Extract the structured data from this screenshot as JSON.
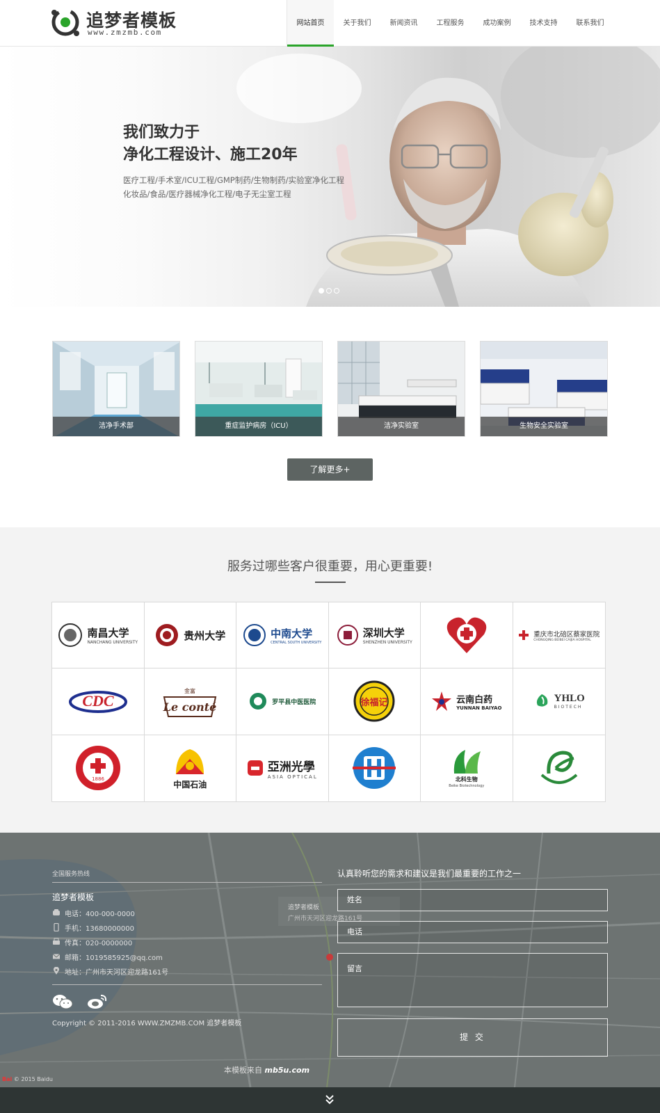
{
  "header": {
    "brand_name": "追梦者模板",
    "brand_url": "www.zmzmb.com",
    "nav": [
      {
        "label": "网站首页",
        "active": true
      },
      {
        "label": "关于我们"
      },
      {
        "label": "新闻资讯"
      },
      {
        "label": "工程服务"
      },
      {
        "label": "成功案例"
      },
      {
        "label": "技术支持"
      },
      {
        "label": "联系我们"
      }
    ]
  },
  "banner": {
    "headline_line1": "我们致力于",
    "headline_line2": "净化工程设计、施工20年",
    "sub_line1": "医疗工程/手术室/ICU工程/GMP制药/生物制药/实验室净化工程",
    "sub_line2": "化妆品/食品/医疗器械净化工程/电子无尘室工程",
    "slides": 3,
    "active_slide": 1
  },
  "services": {
    "items": [
      {
        "caption": "洁净手术部"
      },
      {
        "caption": "重症监护病房（ICU）"
      },
      {
        "caption": "洁净实验室"
      },
      {
        "caption": "生物安全实验室"
      }
    ],
    "more_label": "了解更多+"
  },
  "clients": {
    "title": "服务过哪些客户很重要，用心更重要!",
    "logos": [
      {
        "name": "南昌大学",
        "sub": "NANCHANG UNIVERSITY"
      },
      {
        "name": "贵州大学",
        "sub": ""
      },
      {
        "name": "中南大学",
        "sub": "CENTRAL SOUTH UNIVERSITY"
      },
      {
        "name": "深圳大学",
        "sub": "SHENZHEN UNIVERSITY"
      },
      {
        "name": "",
        "sub": ""
      },
      {
        "name": "重庆市北碚区蔡家医院",
        "sub": "CHONGQING BEIBEI CAIJIA HOSPITAL"
      },
      {
        "name": "CDC",
        "sub": ""
      },
      {
        "name": "Le conté",
        "sub": "金富"
      },
      {
        "name": "罗平县中医医院",
        "sub": ""
      },
      {
        "name": "徐福记",
        "sub": ""
      },
      {
        "name": "云南白药",
        "sub": "YUNNAN BAIYAO"
      },
      {
        "name": "YHLO",
        "sub": "BIOTECH"
      },
      {
        "name": "",
        "sub": "1886"
      },
      {
        "name": "中国石油",
        "sub": ""
      },
      {
        "name": "亞洲光學",
        "sub": "ASIA OPTICAL"
      },
      {
        "name": "",
        "sub": ""
      },
      {
        "name": "北科生物",
        "sub": "Beike Biotechnology"
      },
      {
        "name": "",
        "sub": ""
      }
    ]
  },
  "footer": {
    "hotline_label": "全国服务热线",
    "company": "追梦者模板",
    "phone": "电话：400-000-0000",
    "mobile": "手机：13680000000",
    "fax": "传真：020-0000000",
    "email": "邮箱：1019585925@qq.com",
    "address": "地址：广州市天河区迎龙路161号",
    "copyright": "Copyright © 2011-2016 WWW.ZMZMB.COM 追梦者模板",
    "form_lead": "认真聆听您的需求和建议是我们最重要的工作之一",
    "name_placeholder": "姓名",
    "phone_placeholder": "电话",
    "message_placeholder": "留言",
    "submit_label": "提 交",
    "map_credit_prefix": "本模板来自",
    "map_credit_brand": "mb5u.com",
    "map_popup_title": "追梦者模板",
    "map_popup_addr": "广州市天河区迎龙路161号",
    "baidu_brand": "Bai",
    "baidu_copy": "© 2015 Baidu"
  },
  "colors": {
    "accent": "#2aa42a",
    "button": "#5d6462",
    "footer_bar": "#2e3534"
  }
}
